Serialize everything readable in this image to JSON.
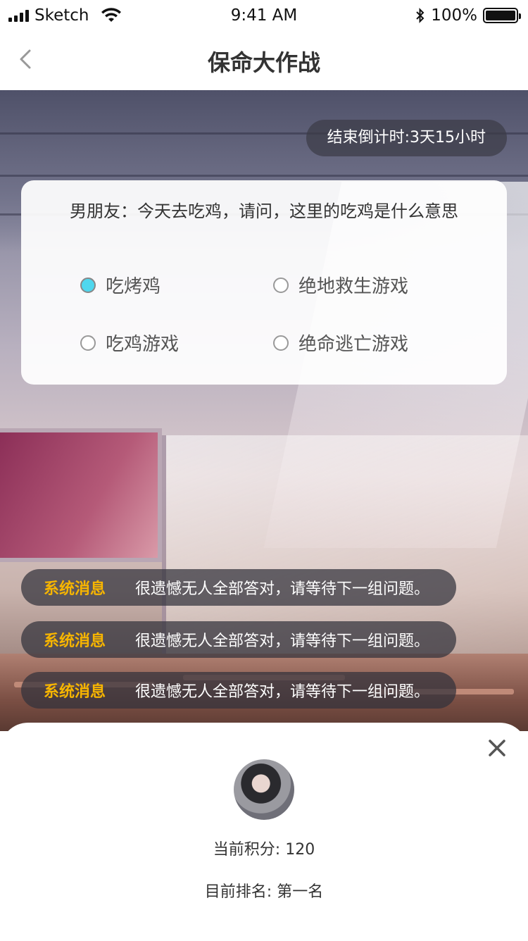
{
  "status_bar": {
    "carrier": "Sketch",
    "time": "9:41 AM",
    "battery": "100%"
  },
  "nav": {
    "title": "保命大作战"
  },
  "countdown": {
    "text": "结束倒计时:3天15小时"
  },
  "question": {
    "text": "男朋友：今天去吃鸡，请问，这里的吃鸡是什么意思",
    "options": [
      {
        "label": "吃烤鸡",
        "selected": true
      },
      {
        "label": "绝地救生游戏",
        "selected": false
      },
      {
        "label": "吃鸡游戏",
        "selected": false
      },
      {
        "label": "绝命逃亡游戏",
        "selected": false
      }
    ]
  },
  "messages": [
    {
      "tag": "系统消息",
      "text": "很遗憾无人全部答对，请等待下一组问题。"
    },
    {
      "tag": "系统消息",
      "text": "很遗憾无人全部答对，请等待下一组问题。"
    },
    {
      "tag": "系统消息",
      "text": "很遗憾无人全部答对，请等待下一组问题。"
    }
  ],
  "profile": {
    "score": "当前积分: 120",
    "rank": "目前排名: 第一名"
  },
  "colors": {
    "accent_tag": "#f7b500",
    "radio_selected": "#4fd7ee"
  }
}
